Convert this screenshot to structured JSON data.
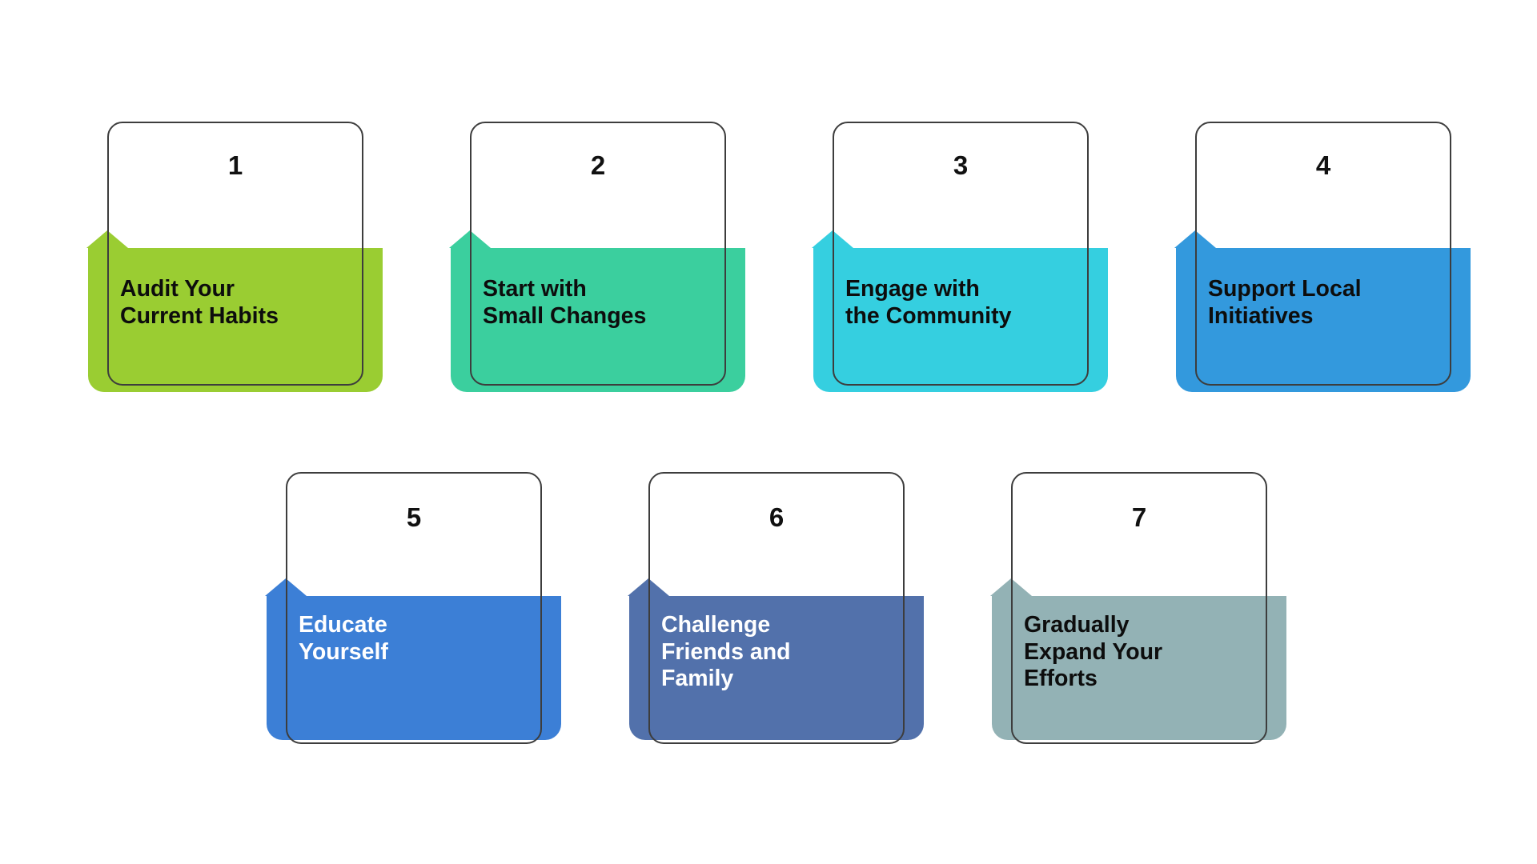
{
  "diagram": {
    "type": "process-steps",
    "title": "",
    "rows": [
      {
        "count": 4
      },
      {
        "count": 3
      }
    ],
    "steps": [
      {
        "number": "1",
        "label": "Audit Your\nCurrent Habits",
        "color": "#9ACD32",
        "text_color": "#0d0d0d",
        "row": 1,
        "column": 1
      },
      {
        "number": "2",
        "label": "Start with\nSmall Changes",
        "color": "#3BCF9E",
        "text_color": "#0d0d0d",
        "row": 1,
        "column": 2
      },
      {
        "number": "3",
        "label": "Engage with\nthe Community",
        "color": "#35CFE0",
        "text_color": "#0d0d0d",
        "row": 1,
        "column": 3
      },
      {
        "number": "4",
        "label": "Support Local\nInitiatives",
        "color": "#3399DD",
        "text_color": "#0d0d0d",
        "row": 1,
        "column": 4
      },
      {
        "number": "5",
        "label": "Educate\nYourself",
        "color": "#3C7FD6",
        "text_color": "#ffffff",
        "row": 2,
        "column": 1
      },
      {
        "number": "6",
        "label": "Challenge\nFriends and\nFamily",
        "color": "#5271AB",
        "text_color": "#ffffff",
        "row": 2,
        "column": 2
      },
      {
        "number": "7",
        "label": "Gradually\nExpand Your\nEfforts",
        "color": "#93B2B5",
        "text_color": "#0d0d0d",
        "row": 2,
        "column": 3
      }
    ],
    "style": {
      "background": "#ffffff",
      "outline_color": "#3d3d3d"
    }
  }
}
